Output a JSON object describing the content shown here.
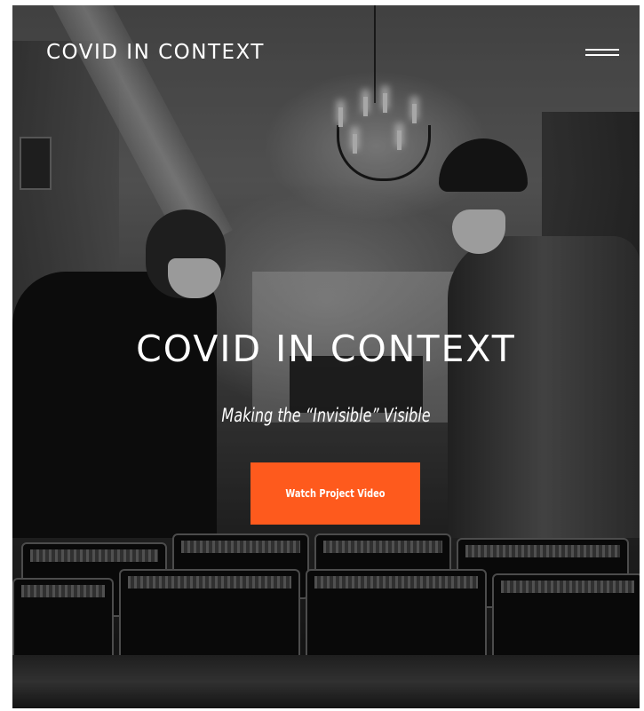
{
  "header": {
    "logo_text": "COVID IN CONTEXT",
    "menu_icon": "hamburger-menu-icon"
  },
  "hero": {
    "title": "COVID IN CONTEXT",
    "subtitle": "Making the “Invisible” Visible",
    "cta_label": "Watch Project Video",
    "image": "black-and-white photo of two masked workers packing meal trays"
  },
  "colors": {
    "cta_background": "#fe5a1d",
    "text": "#ffffff",
    "page_background": "#ffffff"
  }
}
